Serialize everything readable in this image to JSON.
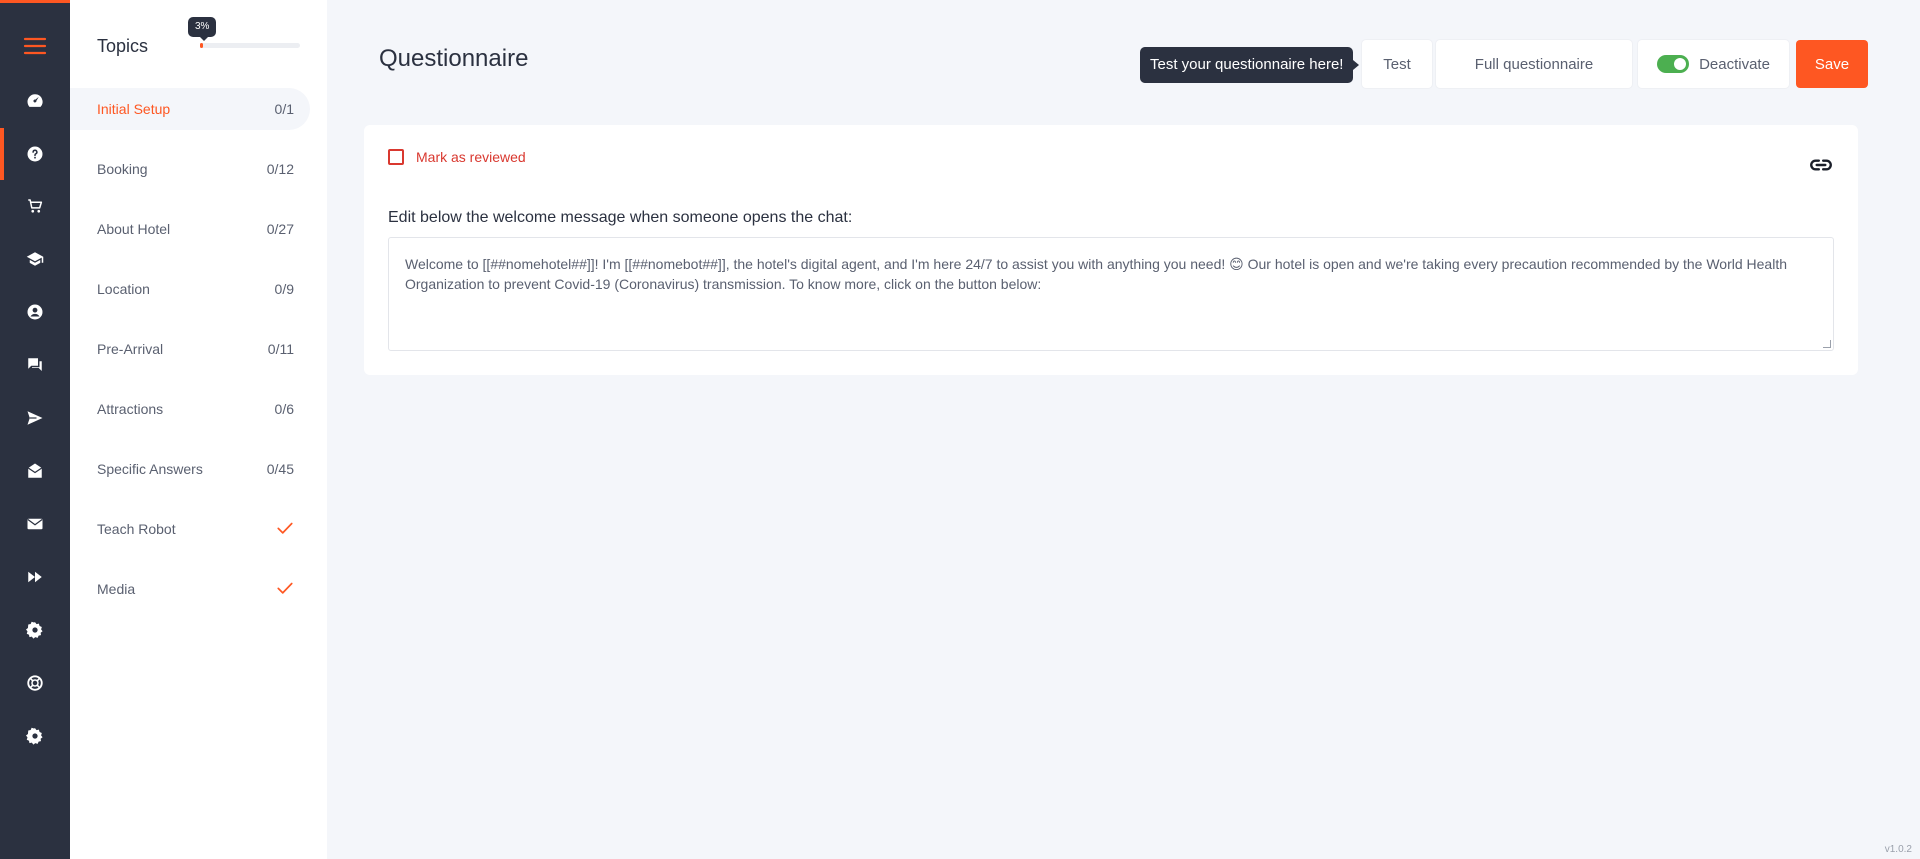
{
  "sidebar": {
    "icons": [
      {
        "name": "menu-icon"
      },
      {
        "name": "dashboard-icon"
      },
      {
        "name": "questionnaire-icon",
        "active": true
      },
      {
        "name": "cart-icon"
      },
      {
        "name": "graduation-icon"
      },
      {
        "name": "user-icon"
      },
      {
        "name": "chat-icon"
      },
      {
        "name": "send-icon"
      },
      {
        "name": "inbox-icon"
      },
      {
        "name": "mail-icon"
      },
      {
        "name": "fast-forward-icon"
      },
      {
        "name": "settings-icon"
      },
      {
        "name": "support-icon"
      },
      {
        "name": "admin-settings-icon"
      }
    ]
  },
  "topics": {
    "title": "Topics",
    "progress_label": "3%",
    "progress_fraction": 0.03,
    "items": [
      {
        "label": "Initial Setup",
        "count": "0/1",
        "active": true
      },
      {
        "label": "Booking",
        "count": "0/12"
      },
      {
        "label": "About Hotel",
        "count": "0/27"
      },
      {
        "label": "Location",
        "count": "0/9"
      },
      {
        "label": "Pre-Arrival",
        "count": "0/11"
      },
      {
        "label": "Attractions",
        "count": "0/6"
      },
      {
        "label": "Specific Answers",
        "count": "0/45"
      },
      {
        "label": "Teach Robot",
        "count": "",
        "check": true
      },
      {
        "label": "Media",
        "count": "",
        "check": true
      }
    ]
  },
  "header": {
    "title": "Questionnaire",
    "tooltip": "Test your questionnaire here!",
    "test_label": "Test",
    "full_label": "Full questionnaire",
    "deactivate_label": "Deactivate",
    "save_label": "Save"
  },
  "card": {
    "reviewed_label": "Mark as reviewed",
    "edit_label": "Edit below the welcome message when someone opens the chat:",
    "message": "Welcome to [[##nomehotel##]]! I'm [[##nomebot##]], the hotel's digital agent, and I'm here 24/7 to assist you with anything you need! 😊 Our hotel is open and we're taking every precaution recommended by the World Health Organization to prevent Covid-19 (Coronavirus) transmission. To know more, click on the button below:"
  },
  "footer": {
    "version": "v1.0.2"
  },
  "colors": {
    "accent": "#fe5722",
    "rail": "#2b3140",
    "toggle_on": "#4caf50",
    "danger": "#d9382f"
  }
}
